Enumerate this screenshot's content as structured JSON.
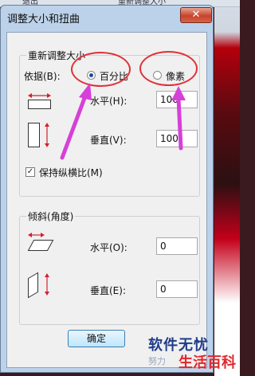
{
  "background": {
    "tab_left": "退出",
    "tab_right": "重新调整大小"
  },
  "dialog": {
    "title": "调整大小和扭曲",
    "close_glyph": "✕"
  },
  "resize": {
    "group_label": "重新调整大小",
    "by_label": "依据(B):",
    "percent_option": "百分比",
    "pixel_option": "像素",
    "selected": "percent",
    "horizontal_label": "水平(H):",
    "horizontal_value": "100",
    "vertical_label": "垂直(V):",
    "vertical_value": "100",
    "maintain_aspect_label": "保持纵横比(M)",
    "maintain_aspect_checked": true
  },
  "skew": {
    "group_label": "倾斜(角度)",
    "horizontal_label": "水平(O):",
    "horizontal_value": "0",
    "vertical_label": "垂直(E):",
    "vertical_value": "0"
  },
  "buttons": {
    "ok_label": "确定"
  },
  "watermark": {
    "main": "软件无忧",
    "sub": "努力",
    "red": "生活百科"
  },
  "colors": {
    "annotation": "#e0303a",
    "arrow": "#d640d8",
    "accent_icon": "#d4202a"
  }
}
